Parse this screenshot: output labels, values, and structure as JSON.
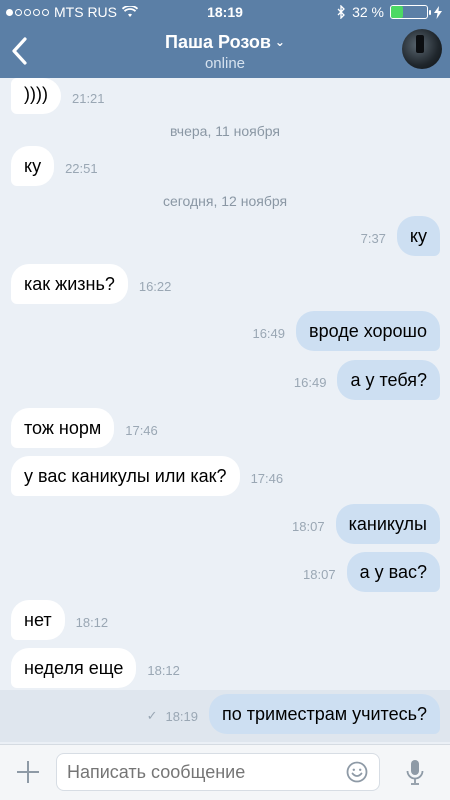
{
  "status": {
    "carrier": "MTS RUS",
    "time": "18:19",
    "battery": "32 %",
    "battery_level": 0.32
  },
  "header": {
    "back_icon": "chevron-left-icon",
    "name": "Паша Розов",
    "status": "online",
    "dropdown_icon": "chevron-down-icon"
  },
  "chat": {
    "m1": {
      "text": "))))",
      "time": "21:21"
    },
    "d1": "вчера, 11 ноября",
    "m2": {
      "text": "ку",
      "time": "22:51"
    },
    "d2": "сегодня, 12 ноября",
    "m3": {
      "text": "ку",
      "time": "7:37"
    },
    "m4": {
      "text": "как жизнь?",
      "time": "16:22"
    },
    "m5": {
      "text": "вроде хорошо",
      "time": "16:49"
    },
    "m6": {
      "text": "а у тебя?",
      "time": "16:49"
    },
    "m7": {
      "text": "тож норм",
      "time": "17:46"
    },
    "m8": {
      "text": "у вас каникулы или как?",
      "time": "17:46"
    },
    "m9": {
      "text": "каникулы",
      "time": "18:07"
    },
    "m10": {
      "text": "а у вас?",
      "time": "18:07"
    },
    "m11": {
      "text": "нет",
      "time": "18:12"
    },
    "m12": {
      "text": "неделя еще",
      "time": "18:12"
    },
    "m13": {
      "text": "по триместрам учитесь?",
      "time": "18:19",
      "status_icon": "checkmark-icon"
    }
  },
  "composer": {
    "placeholder": "Написать сообщение"
  },
  "colors": {
    "header": "#5b7fa6",
    "background": "#ebf0f6",
    "outgoing": "#cddff2",
    "incoming": "#ffffff"
  }
}
